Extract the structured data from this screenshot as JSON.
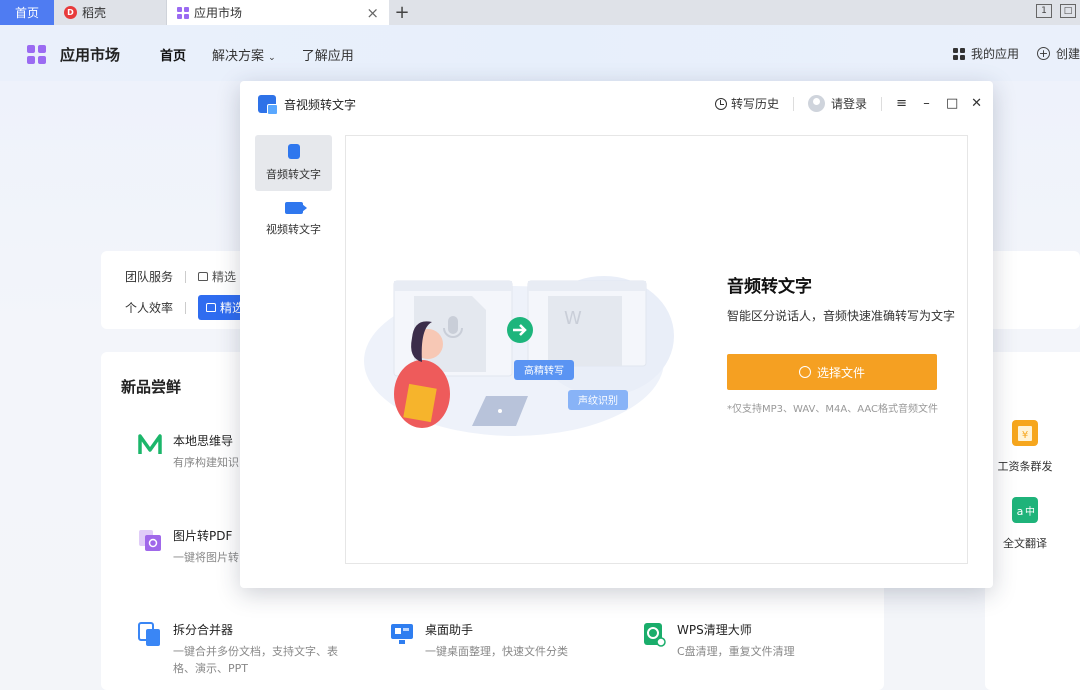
{
  "tabs": {
    "home": "首页",
    "items": [
      {
        "label": "稻壳"
      },
      {
        "label": "应用市场"
      }
    ],
    "right_badges": [
      "1",
      "□"
    ]
  },
  "header": {
    "brand": "应用市场",
    "nav": [
      "首页",
      "解决方案",
      "了解应用"
    ],
    "my_apps": "我的应用",
    "create": "创建"
  },
  "filters": {
    "row1_label": "团队服务",
    "row1_chip": "精选",
    "row2_label": "个人效率",
    "row2_chip": "精选"
  },
  "new_products": {
    "title": "新品尝鲜",
    "items": [
      {
        "name": "本地思维导",
        "desc": "有序构建知识"
      },
      {
        "name": "图片转PDF",
        "desc": "一键将图片转"
      },
      {
        "name": "拆分合并器",
        "desc": "一键合并多份文档，支持文字、表",
        "desc2": "格、演示、PPT"
      },
      {
        "name": "桌面助手",
        "desc": "一键桌面整理，快速文件分类"
      },
      {
        "name": "WPS清理大师",
        "desc": "C盘清理，重复文件清理"
      }
    ]
  },
  "right_apps": [
    {
      "name": "工资条群发"
    },
    {
      "name": "全文翻译"
    }
  ],
  "modal": {
    "title": "音视频转文字",
    "history": "转写历史",
    "login": "请登录",
    "sidebar": [
      {
        "label": "音频转文字"
      },
      {
        "label": "视频转文字"
      }
    ],
    "heading": "音频转文字",
    "subtitle": "智能区分说话人，音频快速准确转写为文字",
    "button": "选择文件",
    "note": "*仅支持MP3、WAV、M4A、AAC格式音频文件",
    "bubble1": "高精转写",
    "bubble2": "声纹识别"
  },
  "colors": {
    "accent": "#2f6cf0",
    "orange": "#f5a022",
    "tab_home": "#4f7cf2"
  }
}
